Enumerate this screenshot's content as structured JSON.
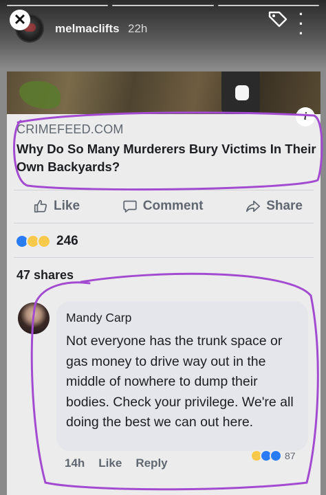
{
  "story": {
    "username": "melmaclifts",
    "time": "22h",
    "progress_segments": 3
  },
  "post": {
    "source": "CRIMEFEED.COM",
    "headline": "Why Do So Many Murderers Bury Victims In Their Own Backyards?",
    "actions": {
      "like": "Like",
      "comment": "Comment",
      "share": "Share"
    },
    "reaction_count": "246",
    "shares": "47 shares"
  },
  "comment": {
    "author": "Mandy Carp",
    "text": "Not everyone has the trunk space or gas money to drive way out in the middle of nowhere to dump their bodies. Check your privilege. We're all doing the best we can out here.",
    "time": "14h",
    "like": "Like",
    "reply": "Reply",
    "reaction_count": "87"
  },
  "colors": {
    "marker": "#a24bd0",
    "like_blue": "#2a7cf6",
    "emoji_yellow": "#f7c94a"
  }
}
